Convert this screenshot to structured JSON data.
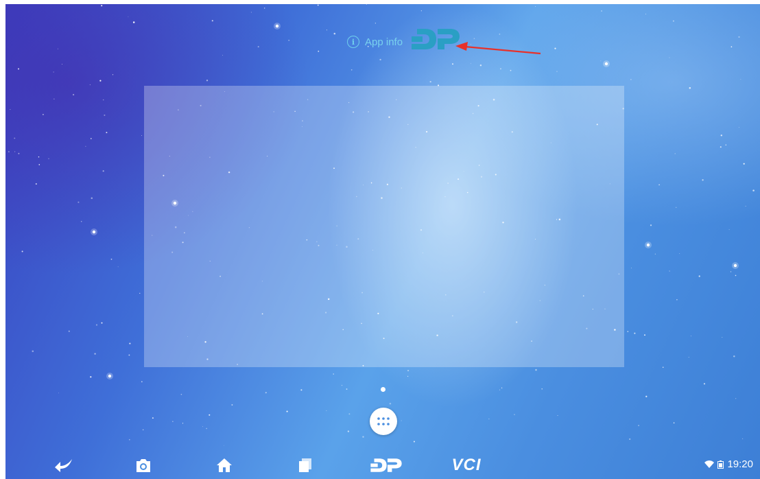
{
  "drag_menu": {
    "app_info_label": "App info"
  },
  "dock": {
    "all_apps_icon": "apps-grid-icon"
  },
  "nav_bar": {
    "back_icon": "back-arrow-icon",
    "screenshot_icon": "camera-icon",
    "home_icon": "home-icon",
    "recents_icon": "recents-icon",
    "dp_icon": "dp-logo-icon",
    "vci_label": "VCI"
  },
  "status_bar": {
    "wifi_icon": "wifi-icon",
    "battery_icon": "battery-icon",
    "time": "19:20"
  },
  "colors": {
    "accent": "#2a8fb4",
    "annotation_arrow": "#e8312a",
    "app_info_text": "#79d2ee"
  }
}
